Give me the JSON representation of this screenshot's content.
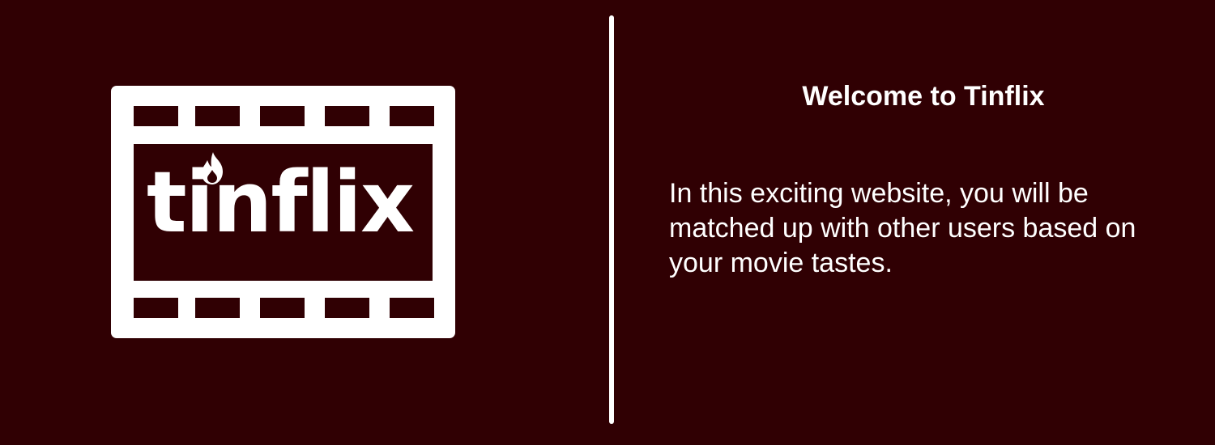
{
  "logo": {
    "wordmark": "tinflix",
    "icon": "film-strip-icon",
    "flame_icon": "flame-icon"
  },
  "welcome": {
    "title": "Welcome to Tinflix",
    "body": "In this exciting website, you will be matched up with other users based on your movie tastes."
  },
  "colors": {
    "background": "#300003",
    "foreground": "#ffffff"
  }
}
